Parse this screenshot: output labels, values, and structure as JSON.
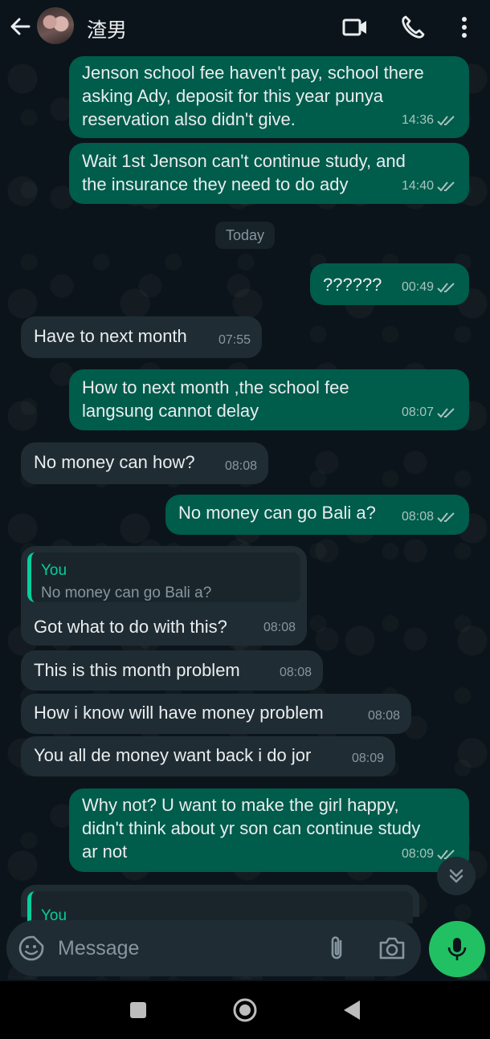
{
  "header": {
    "contact_name": "渣男",
    "icons": [
      "back-arrow-icon",
      "video-call-icon",
      "voice-call-icon",
      "more-options-icon"
    ]
  },
  "messages": [
    {
      "dir": "out",
      "text": "Jenson school fee haven't pay, school there\nasking Ady, deposit for this year punya\nreservation also didn't give.",
      "time": "14:36",
      "read": true
    },
    {
      "dir": "out",
      "text": "Wait 1st Jenson can't continue study, and\nthe insurance they need to do ady",
      "time": "14:40",
      "read": true
    },
    {
      "dir": "out",
      "text": "??????",
      "time": "00:49",
      "read": true
    },
    {
      "dir": "in",
      "text": "Have to next month",
      "time": "07:55"
    },
    {
      "dir": "out",
      "text": "How to next month ,the school fee\nlangsung cannot delay",
      "time": "08:07",
      "read": true
    },
    {
      "dir": "in",
      "text": "No money can how?",
      "time": "08:08"
    },
    {
      "dir": "out",
      "text": "No money can go Bali a?",
      "time": "08:08",
      "read": true
    },
    {
      "dir": "in",
      "text": "Got what to do with this?",
      "time": "08:08",
      "quote": {
        "author": "You",
        "text": "No money can go Bali a?"
      }
    },
    {
      "dir": "in",
      "text": "This is this month problem",
      "time": "08:08"
    },
    {
      "dir": "in",
      "text": "How i know will have money problem",
      "time": "08:08"
    },
    {
      "dir": "in",
      "text": "You all de money want back i do jor",
      "time": "08:09"
    },
    {
      "dir": "out",
      "text": "Why not? U want to make the girl happy,\ndidn't think about yr son can continue study\nar not",
      "time": "08:09",
      "read": true
    },
    {
      "dir": "in",
      "text": "",
      "time": "",
      "quote": {
        "author": "You",
        "text": ""
      }
    }
  ],
  "date_separator": "Today",
  "composer": {
    "placeholder": "Message",
    "icons": [
      "emoji-sticker-icon",
      "attach-icon",
      "camera-icon",
      "mic-icon"
    ]
  },
  "colors": {
    "background": "#0b141a",
    "outgoing_bubble": "#005c4b",
    "incoming_bubble": "#202c33",
    "accent": "#21c063",
    "quote_accent": "#06cf9c"
  }
}
